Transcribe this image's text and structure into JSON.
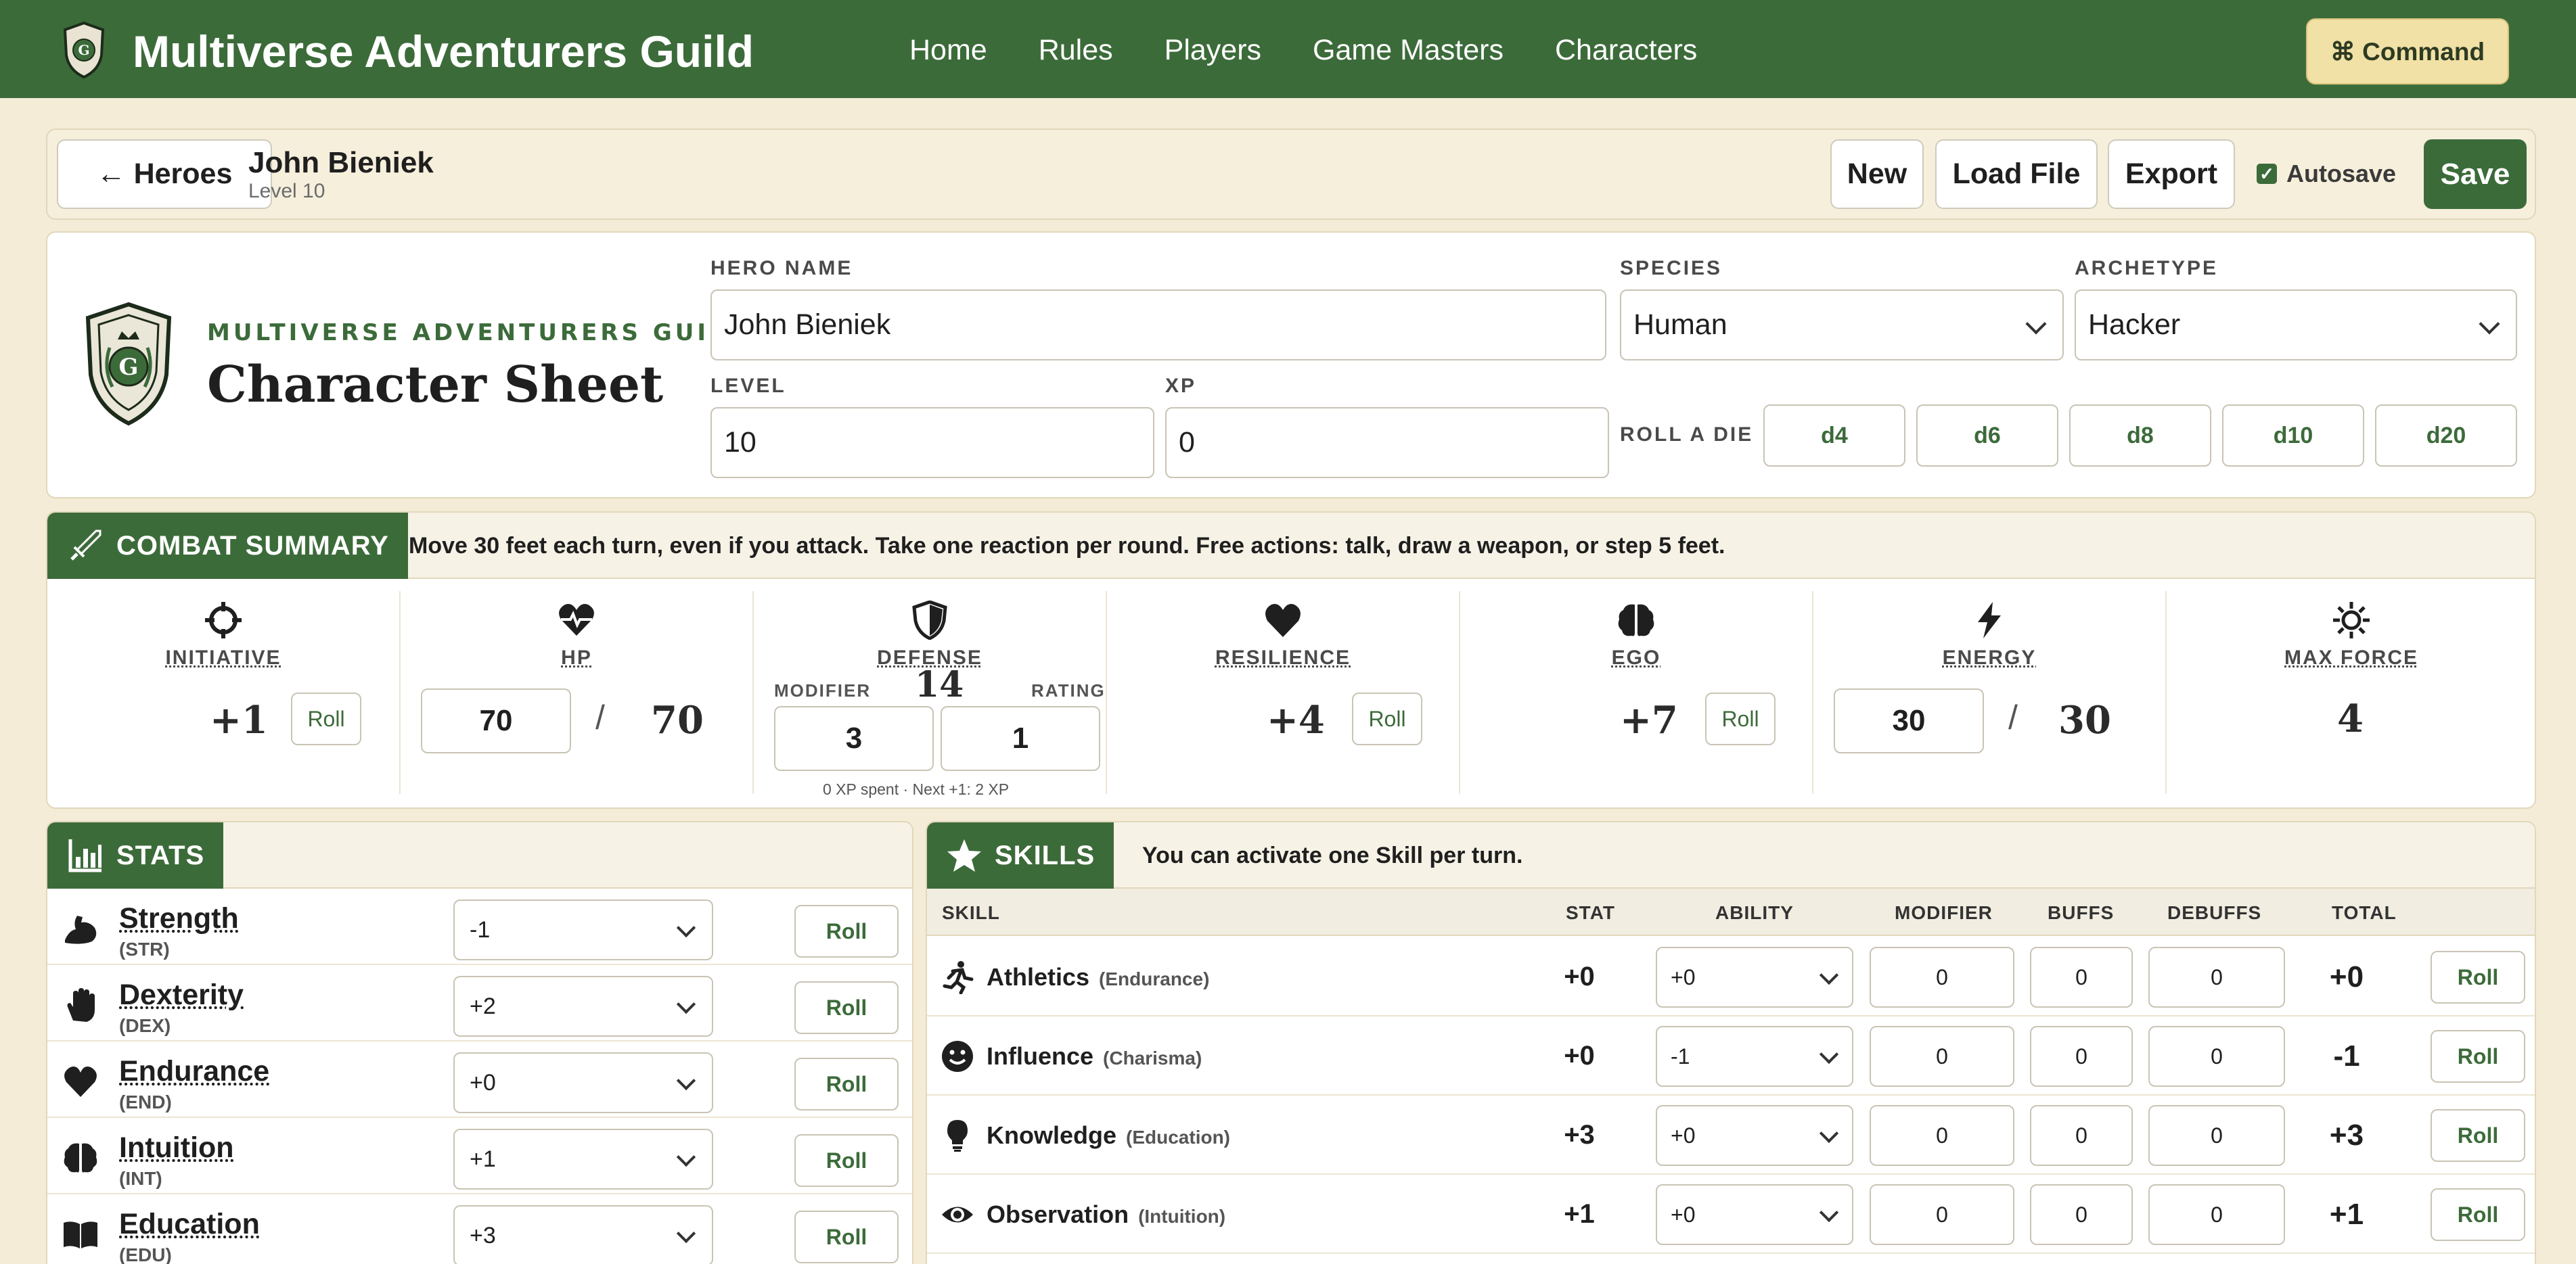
{
  "nav": {
    "title": "Multiverse Adventurers Guild",
    "links": [
      "Home",
      "Rules",
      "Players",
      "Game Masters",
      "Characters"
    ],
    "command_label": "⌘ Command"
  },
  "hero_bar": {
    "back_label": "← Heroes",
    "name": "John Bieniek",
    "level": "Level 10",
    "new_label": "New",
    "load_label": "Load File",
    "export_label": "Export",
    "autosave_label": "Autosave",
    "autosave_checked": true,
    "save_label": "Save"
  },
  "header": {
    "guild": "MULTIVERSE ADVENTURERS GUILD",
    "title": "Character Sheet",
    "hero_name_label": "HERO NAME",
    "hero_name_value": "John Bieniek",
    "species_label": "SPECIES",
    "species_value": "Human",
    "archetype_label": "ARCHETYPE",
    "archetype_value": "Hacker",
    "level_label": "LEVEL",
    "level_value": "10",
    "xp_label": "XP",
    "xp_value": "0",
    "roll_die_label": "ROLL A DIE",
    "dice": [
      "d4",
      "d6",
      "d8",
      "d10",
      "d20"
    ]
  },
  "combat": {
    "title": "COMBAT SUMMARY",
    "note": "Move 30 feet each turn, even if you attack. Take one reaction per round. Free actions: talk, draw a weapon, or step 5 feet.",
    "initiative": {
      "label": "INITIATIVE",
      "value": "+1",
      "roll": "Roll"
    },
    "hp": {
      "label": "HP",
      "current": "70",
      "slash": "/",
      "max": "70"
    },
    "defense": {
      "label": "DEFENSE",
      "value": "14",
      "modifier_label": "MODIFIER",
      "rating_label": "RATING",
      "modifier": "3",
      "rating": "1",
      "xp_note": "0 XP spent · Next +1: 2 XP"
    },
    "resilience": {
      "label": "RESILIENCE",
      "value": "+4",
      "roll": "Roll"
    },
    "ego": {
      "label": "EGO",
      "value": "+7",
      "roll": "Roll"
    },
    "energy": {
      "label": "ENERGY",
      "current": "30",
      "slash": "/",
      "max": "30"
    },
    "max_force": {
      "label": "MAX FORCE",
      "value": "4"
    }
  },
  "stats": {
    "title": "STATS",
    "items": [
      {
        "name": "Strength",
        "abbr": "(STR)",
        "value": "-1",
        "roll": "Roll",
        "icon": "muscle-icon"
      },
      {
        "name": "Dexterity",
        "abbr": "(DEX)",
        "value": "+2",
        "roll": "Roll",
        "icon": "hand-icon"
      },
      {
        "name": "Endurance",
        "abbr": "(END)",
        "value": "+0",
        "roll": "Roll",
        "icon": "heart-icon"
      },
      {
        "name": "Intuition",
        "abbr": "(INT)",
        "value": "+1",
        "roll": "Roll",
        "icon": "brain-icon"
      },
      {
        "name": "Education",
        "abbr": "(EDU)",
        "value": "+3",
        "roll": "Roll",
        "icon": "book-icon"
      }
    ]
  },
  "skills": {
    "title": "SKILLS",
    "note": "You can activate one Skill per turn.",
    "headers": [
      "SKILL",
      "STAT",
      "ABILITY",
      "MODIFIER",
      "BUFFS",
      "DEBUFFS",
      "TOTAL"
    ],
    "items": [
      {
        "name": "Athletics",
        "base": "(Endurance)",
        "stat": "+0",
        "ability": "+0",
        "modifier": "0",
        "buffs": "0",
        "debuffs": "0",
        "total": "+0",
        "roll": "Roll",
        "icon": "running-icon"
      },
      {
        "name": "Influence",
        "base": "(Charisma)",
        "stat": "+0",
        "ability": "-1",
        "modifier": "0",
        "buffs": "0",
        "debuffs": "0",
        "total": "-1",
        "roll": "Roll",
        "icon": "smile-icon"
      },
      {
        "name": "Knowledge",
        "base": "(Education)",
        "stat": "+3",
        "ability": "+0",
        "modifier": "0",
        "buffs": "0",
        "debuffs": "0",
        "total": "+3",
        "roll": "Roll",
        "icon": "lightbulb-icon"
      },
      {
        "name": "Observation",
        "base": "(Intuition)",
        "stat": "+1",
        "ability": "+0",
        "modifier": "0",
        "buffs": "0",
        "debuffs": "0",
        "total": "+1",
        "roll": "Roll",
        "icon": "eye-icon"
      }
    ]
  },
  "colors": {
    "primary": "#3c6b3a",
    "background": "#f4ecd6",
    "accent": "#f1e1a6"
  }
}
